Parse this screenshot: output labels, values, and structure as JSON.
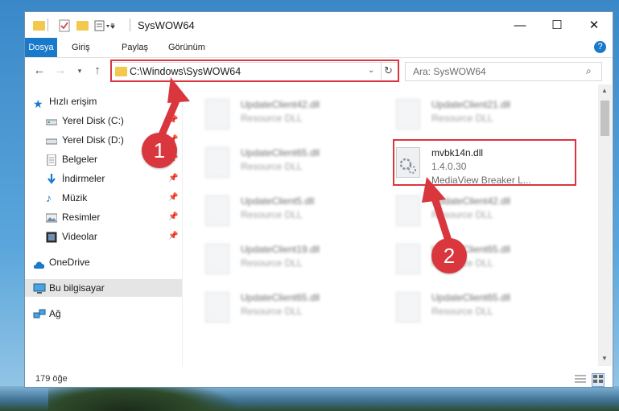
{
  "window": {
    "title": "SysWOW64",
    "controls": {
      "minimize": "—",
      "maximize": "☐",
      "close": "✕"
    }
  },
  "ribbon": {
    "tabs": [
      "Dosya",
      "Giriş",
      "Paylaş",
      "Görünüm"
    ],
    "help": "?"
  },
  "nav": {
    "address": "C:\\Windows\\SysWOW64",
    "search_placeholder": "Ara: SysWOW64"
  },
  "sidebar": {
    "quick_access": "Hızlı erişim",
    "items": [
      {
        "label": "Yerel Disk (C:)",
        "icon": "drive-icon"
      },
      {
        "label": "Yerel Disk (D:)",
        "icon": "drive-icon"
      },
      {
        "label": "Belgeler",
        "icon": "documents-icon"
      },
      {
        "label": "İndirmeler",
        "icon": "downloads-icon"
      },
      {
        "label": "Müzik",
        "icon": "music-icon"
      },
      {
        "label": "Resimler",
        "icon": "pictures-icon"
      },
      {
        "label": "Videolar",
        "icon": "videos-icon"
      }
    ],
    "onedrive": "OneDrive",
    "this_pc": "Bu bilgisayar",
    "network": "Ağ"
  },
  "files": {
    "left": [
      {
        "name": "UpdateClient42.dll",
        "type": "Resource DLL"
      },
      {
        "name": "UpdateClient65.dll",
        "type": "Resource DLL"
      },
      {
        "name": "UpdateClient5.dll",
        "type": "Resource DLL"
      },
      {
        "name": "UpdateClient19.dll",
        "type": "Resource DLL"
      },
      {
        "name": "UpdateClient65.dll",
        "type": "Resource DLL"
      }
    ],
    "right": [
      {
        "name": "UpdateClient21.dll",
        "type": "Resource DLL"
      },
      {
        "name": "UpdateClient42.dll",
        "type": "Resource DLL"
      },
      {
        "name": "UpdateClient65.dll",
        "type": "Resource DLL"
      },
      {
        "name": "UpdateClient65.dll",
        "type": "Resource DLL"
      }
    ],
    "highlighted": {
      "name": "mvbk14n.dll",
      "version": "1.4.0.30",
      "description": "MediaView Breaker L..."
    }
  },
  "status": {
    "count": "179 öğe"
  },
  "annotations": {
    "step1": "1",
    "step2": "2"
  },
  "colors": {
    "accent": "#1979ca",
    "highlight": "#d9363e"
  }
}
